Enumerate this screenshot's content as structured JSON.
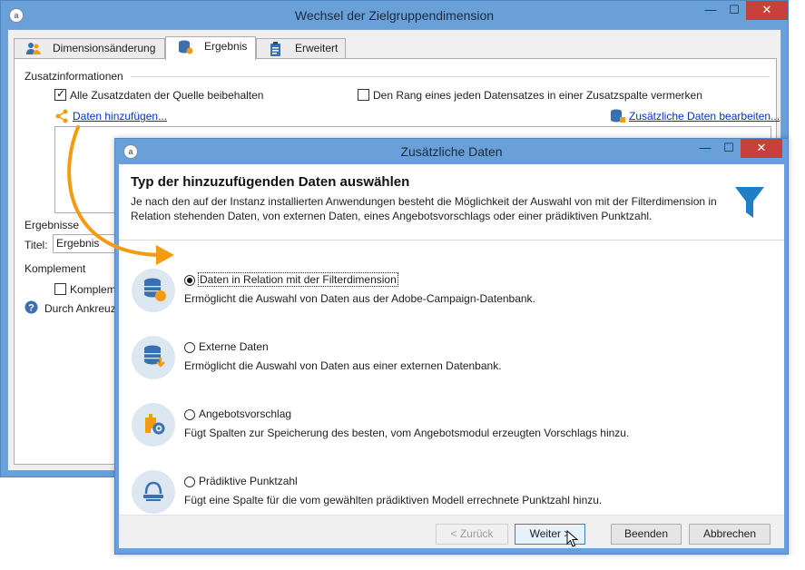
{
  "outer": {
    "title": "Wechsel der Zielgruppendimension",
    "tabs": [
      {
        "label": "Dimensionsänderung"
      },
      {
        "label": "Ergebnis"
      },
      {
        "label": "Erweitert"
      }
    ],
    "section_zusatz": "Zusatzinformationen",
    "check_keep": "Alle Zusatzdaten der Quelle beibehalten",
    "check_rank": "Den Rang eines jeden Datensatzes in einer Zusatzspalte vermerken",
    "link_add": "Daten hinzufügen...",
    "link_edit": "Zusätzliche Daten bearbeiten...",
    "section_results": "Ergebnisse",
    "title_label": "Titel:",
    "title_value": "Ergebnis",
    "section_complement": "Komplement",
    "check_complement": "Komplem",
    "help_text": "Durch Ankreuz"
  },
  "dialog": {
    "title": "Zusätzliche Daten",
    "heading": "Typ der hinzuzufügenden Daten auswählen",
    "description": "Je nach den auf der Instanz installierten Anwendungen besteht die Möglichkeit der Auswahl von mit der Filterdimension in Relation stehenden Daten, von externen Daten, eines Angebotsvorschlags oder einer prädiktiven Punktzahl.",
    "options": [
      {
        "label": "Daten in Relation mit der Filterdimension",
        "desc": "Ermöglicht die Auswahl von Daten aus der Adobe-Campaign-Datenbank.",
        "icon": "database-relation-icon",
        "selected": true
      },
      {
        "label": "Externe Daten",
        "desc": "Ermöglicht die Auswahl von Daten aus einer externen Datenbank.",
        "icon": "database-external-icon",
        "selected": false
      },
      {
        "label": "Angebotsvorschlag",
        "desc": "Fügt Spalten zur Speicherung des besten, vom Angebotsmodul erzeugten Vorschlags hinzu.",
        "icon": "offer-gear-icon",
        "selected": false
      },
      {
        "label": "Prädiktive Punktzahl",
        "desc": "Fügt eine Spalte für die vom gewählten prädiktiven Modell errechnete Punktzahl hinzu.",
        "icon": "predictive-score-icon",
        "selected": false
      }
    ],
    "buttons": {
      "back": "< Zurück",
      "next": "Weiter >",
      "finish": "Beenden",
      "cancel": "Abbrechen"
    }
  },
  "colors": {
    "accent_orange": "#f39c12",
    "title_bar": "#6aa0d8",
    "close_red": "#c7403a",
    "funnel_blue": "#1f7fc4",
    "link_blue": "#0033cc"
  }
}
